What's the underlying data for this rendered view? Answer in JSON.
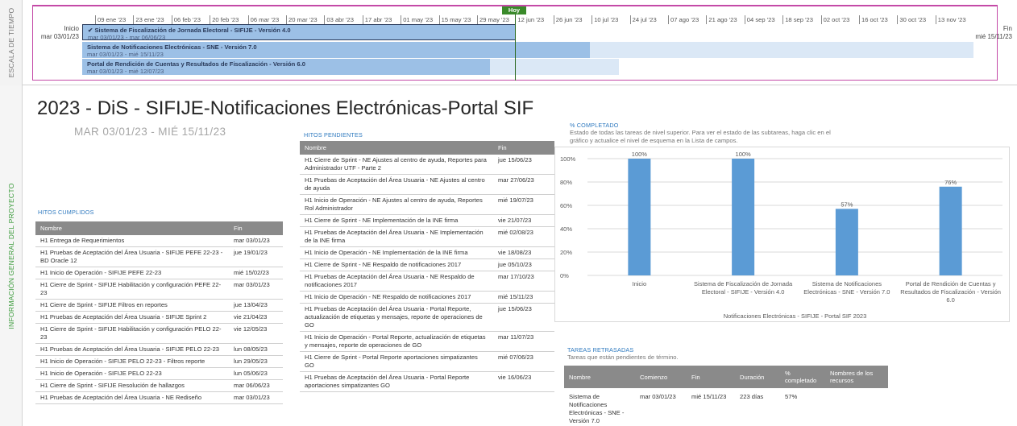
{
  "timeline": {
    "side_label": "ESCALA DE TIEMPO",
    "today_label": "Hoy",
    "start_label": "Inicio",
    "start_date": "mar 03/01/23",
    "end_label": "Fin",
    "end_date": "mié 15/11/23",
    "ticks": [
      "09 ene '23",
      "23 ene '23",
      "06 feb '23",
      "20 feb '23",
      "06 mar '23",
      "20 mar '23",
      "03 abr '23",
      "17 abr '23",
      "01 may '23",
      "15 may '23",
      "29 may '23",
      "12 jun '23",
      "26 jun '23",
      "10 jul '23",
      "24 jul '23",
      "07 ago '23",
      "21 ago '23",
      "04 sep '23",
      "18 sep '23",
      "02 oct '23",
      "16 oct '23",
      "30 oct '23",
      "13 nov '23"
    ],
    "bars": [
      {
        "name": "✔ Sistema de Fiscalización de Jornada Electoral - SIFIJE - Versión 4.0",
        "dates": "mar 03/01/23 - mar 06/06/23",
        "progress": 1.0
      },
      {
        "name": "Sistema de Notificaciones Electrónicas - SNE - Versión 7.0",
        "dates": "mar 03/01/23 - mié 15/11/23",
        "progress": 0.57
      },
      {
        "name": "Portal de Rendición de Cuentas y Resultados de Fiscalización - Versión 6.0",
        "dates": "mar 03/01/23 - mié 12/07/23",
        "progress": 0.76
      }
    ]
  },
  "overview": {
    "side_label": "INFORMACIÓN GENERAL DEL PROYECTO",
    "title": "2023 - DiS - SIFIJE-Notificaciones Electrónicas-Portal SIF",
    "date_range": "MAR 03/01/23 - MIÉ 15/11/23"
  },
  "cumplidos": {
    "heading": "HITOS CUMPLIDOS",
    "col_name": "Nombre",
    "col_end": "Fin",
    "rows": [
      {
        "name": "H1 Entrega de Requerimientos",
        "end": "mar 03/01/23"
      },
      {
        "name": "H1 Pruebas de Aceptación del Área Usuaria - SIFIJE PEFE 22-23 - BD Oracle 12",
        "end": "jue 19/01/23"
      },
      {
        "name": "H1 Inicio de Operación - SIFIJE PEFE 22-23",
        "end": "mié 15/02/23"
      },
      {
        "name": "H1 Cierre de Sprint - SIFIJE Habilitación y configuración PEFE 22-23",
        "end": "mar 03/01/23"
      },
      {
        "name": "H1 Cierre de Sprint - SIFIJE Filtros en reportes",
        "end": "jue 13/04/23"
      },
      {
        "name": "H1 Pruebas de Aceptación del Área Usuaria - SIFIJE Sprint 2",
        "end": "vie 21/04/23"
      },
      {
        "name": "H1 Cierre de Sprint - SIFIJE Habilitación y configuración PELO 22-23",
        "end": "vie 12/05/23"
      },
      {
        "name": "H1 Pruebas de Aceptación del Área Usuaria - SIFIJE PELO 22-23",
        "end": "lun 08/05/23"
      },
      {
        "name": "H1 Inicio de Operación - SIFIJE PELO 22-23 - Filtros reporte",
        "end": "lun 29/05/23"
      },
      {
        "name": "H1 Inicio de Operación - SIFIJE PELO 22-23",
        "end": "lun 05/06/23"
      },
      {
        "name": "H1 Cierre de Sprint - SIFIJE Resolución de hallazgos",
        "end": "mar 06/06/23"
      },
      {
        "name": "H1 Pruebas de Aceptación del Área Usuaria - NE Rediseño",
        "end": "mar 03/01/23"
      }
    ]
  },
  "pendientes": {
    "heading": "HITOS PENDIENTES",
    "col_name": "Nombre",
    "col_end": "Fin",
    "rows": [
      {
        "name": "H1 Cierre de Sprint - NE Ajustes al centro de ayuda, Reportes para Administrador UTF - Parte 2",
        "end": "jue 15/06/23"
      },
      {
        "name": "H1 Pruebas de Aceptación del Área Usuaria - NE Ajustes al centro de ayuda",
        "end": "mar 27/06/23"
      },
      {
        "name": "H1 Inicio de Operación - NE Ajustes al centro de ayuda, Reportes Rol Administrador",
        "end": "mié 19/07/23"
      },
      {
        "name": "H1 Cierre de Sprint - NE Implementación de la INE firma",
        "end": "vie 21/07/23"
      },
      {
        "name": "H1 Pruebas de Aceptación del Área Usuaria - NE Implementación de la INE firma",
        "end": "mié 02/08/23"
      },
      {
        "name": "H1 Inicio de Operación - NE Implementación de la INE firma",
        "end": "vie 18/08/23"
      },
      {
        "name": "H1 Cierre de Sprint - NE Respaldo de notificaciones 2017",
        "end": "jue 05/10/23"
      },
      {
        "name": "H1 Pruebas de Aceptación del Área Usuaria - NE Respaldo de notificaciones 2017",
        "end": "mar 17/10/23"
      },
      {
        "name": "H1 Inicio de Operación - NE Respaldo de notificaciones 2017",
        "end": "mié 15/11/23"
      },
      {
        "name": "H1 Pruebas de Aceptación del Área Usuaria - Portal Reporte, actualización de etiquetas y mensajes, reporte de operaciones de GO",
        "end": "jue 15/06/23"
      },
      {
        "name": "H1 Inicio de Operación - Portal Reporte, actualización de etiquetas y mensajes, reporte de operaciones de GO",
        "end": "mar 11/07/23"
      },
      {
        "name": "H1 Cierre de Sprint - Portal Reporte aportaciones simpatizantes GO",
        "end": "mié 07/06/23"
      },
      {
        "name": "H1 Pruebas de Aceptación del Área Usuaria - Portal Reporte aportaciones simpatizantes GO",
        "end": "vie 16/06/23"
      }
    ]
  },
  "completado": {
    "heading": "% COMPLETADO",
    "description": "Estado de todas las tareas de nivel superior. Para ver el estado de las subtareas, haga clic en el gráfico y actualice el nivel de esquema en la Lista de campos."
  },
  "chart_data": {
    "type": "bar",
    "categories": [
      "Inicio",
      "Sistema de Fiscalización de Jornada Electoral - SIFIJE - Versión 4.0",
      "Sistema de Notificaciones Electrónicas - SNE - Versión 7.0",
      "Portal de Rendición de Cuentas y Resultados de Fiscalización - Versión 6.0"
    ],
    "values": [
      100,
      100,
      57,
      76
    ],
    "data_labels": [
      "100%",
      "100%",
      "57%",
      "76%"
    ],
    "y_ticks": [
      "0%",
      "20%",
      "40%",
      "60%",
      "80%",
      "100%"
    ],
    "ylim": [
      0,
      100
    ],
    "xlabel": "Notificaciones Electrónicas - SIFIJE - Portal SIF 2023",
    "color": "#5b9bd5",
    "grid": true
  },
  "retrasadas": {
    "heading": "TAREAS RETRASADAS",
    "description": "Tareas que están pendientes de término.",
    "cols": [
      "Nombre",
      "Comienzo",
      "Fin",
      "Duración",
      "% completado",
      "Nombres de los recursos"
    ],
    "rows": [
      {
        "name": "Sistema de Notificaciones Electrónicas - SNE - Versión 7.0",
        "start": "mar 03/01/23",
        "end": "mié 15/11/23",
        "duration": "223 días",
        "pct": "57%",
        "resources": ""
      }
    ]
  }
}
